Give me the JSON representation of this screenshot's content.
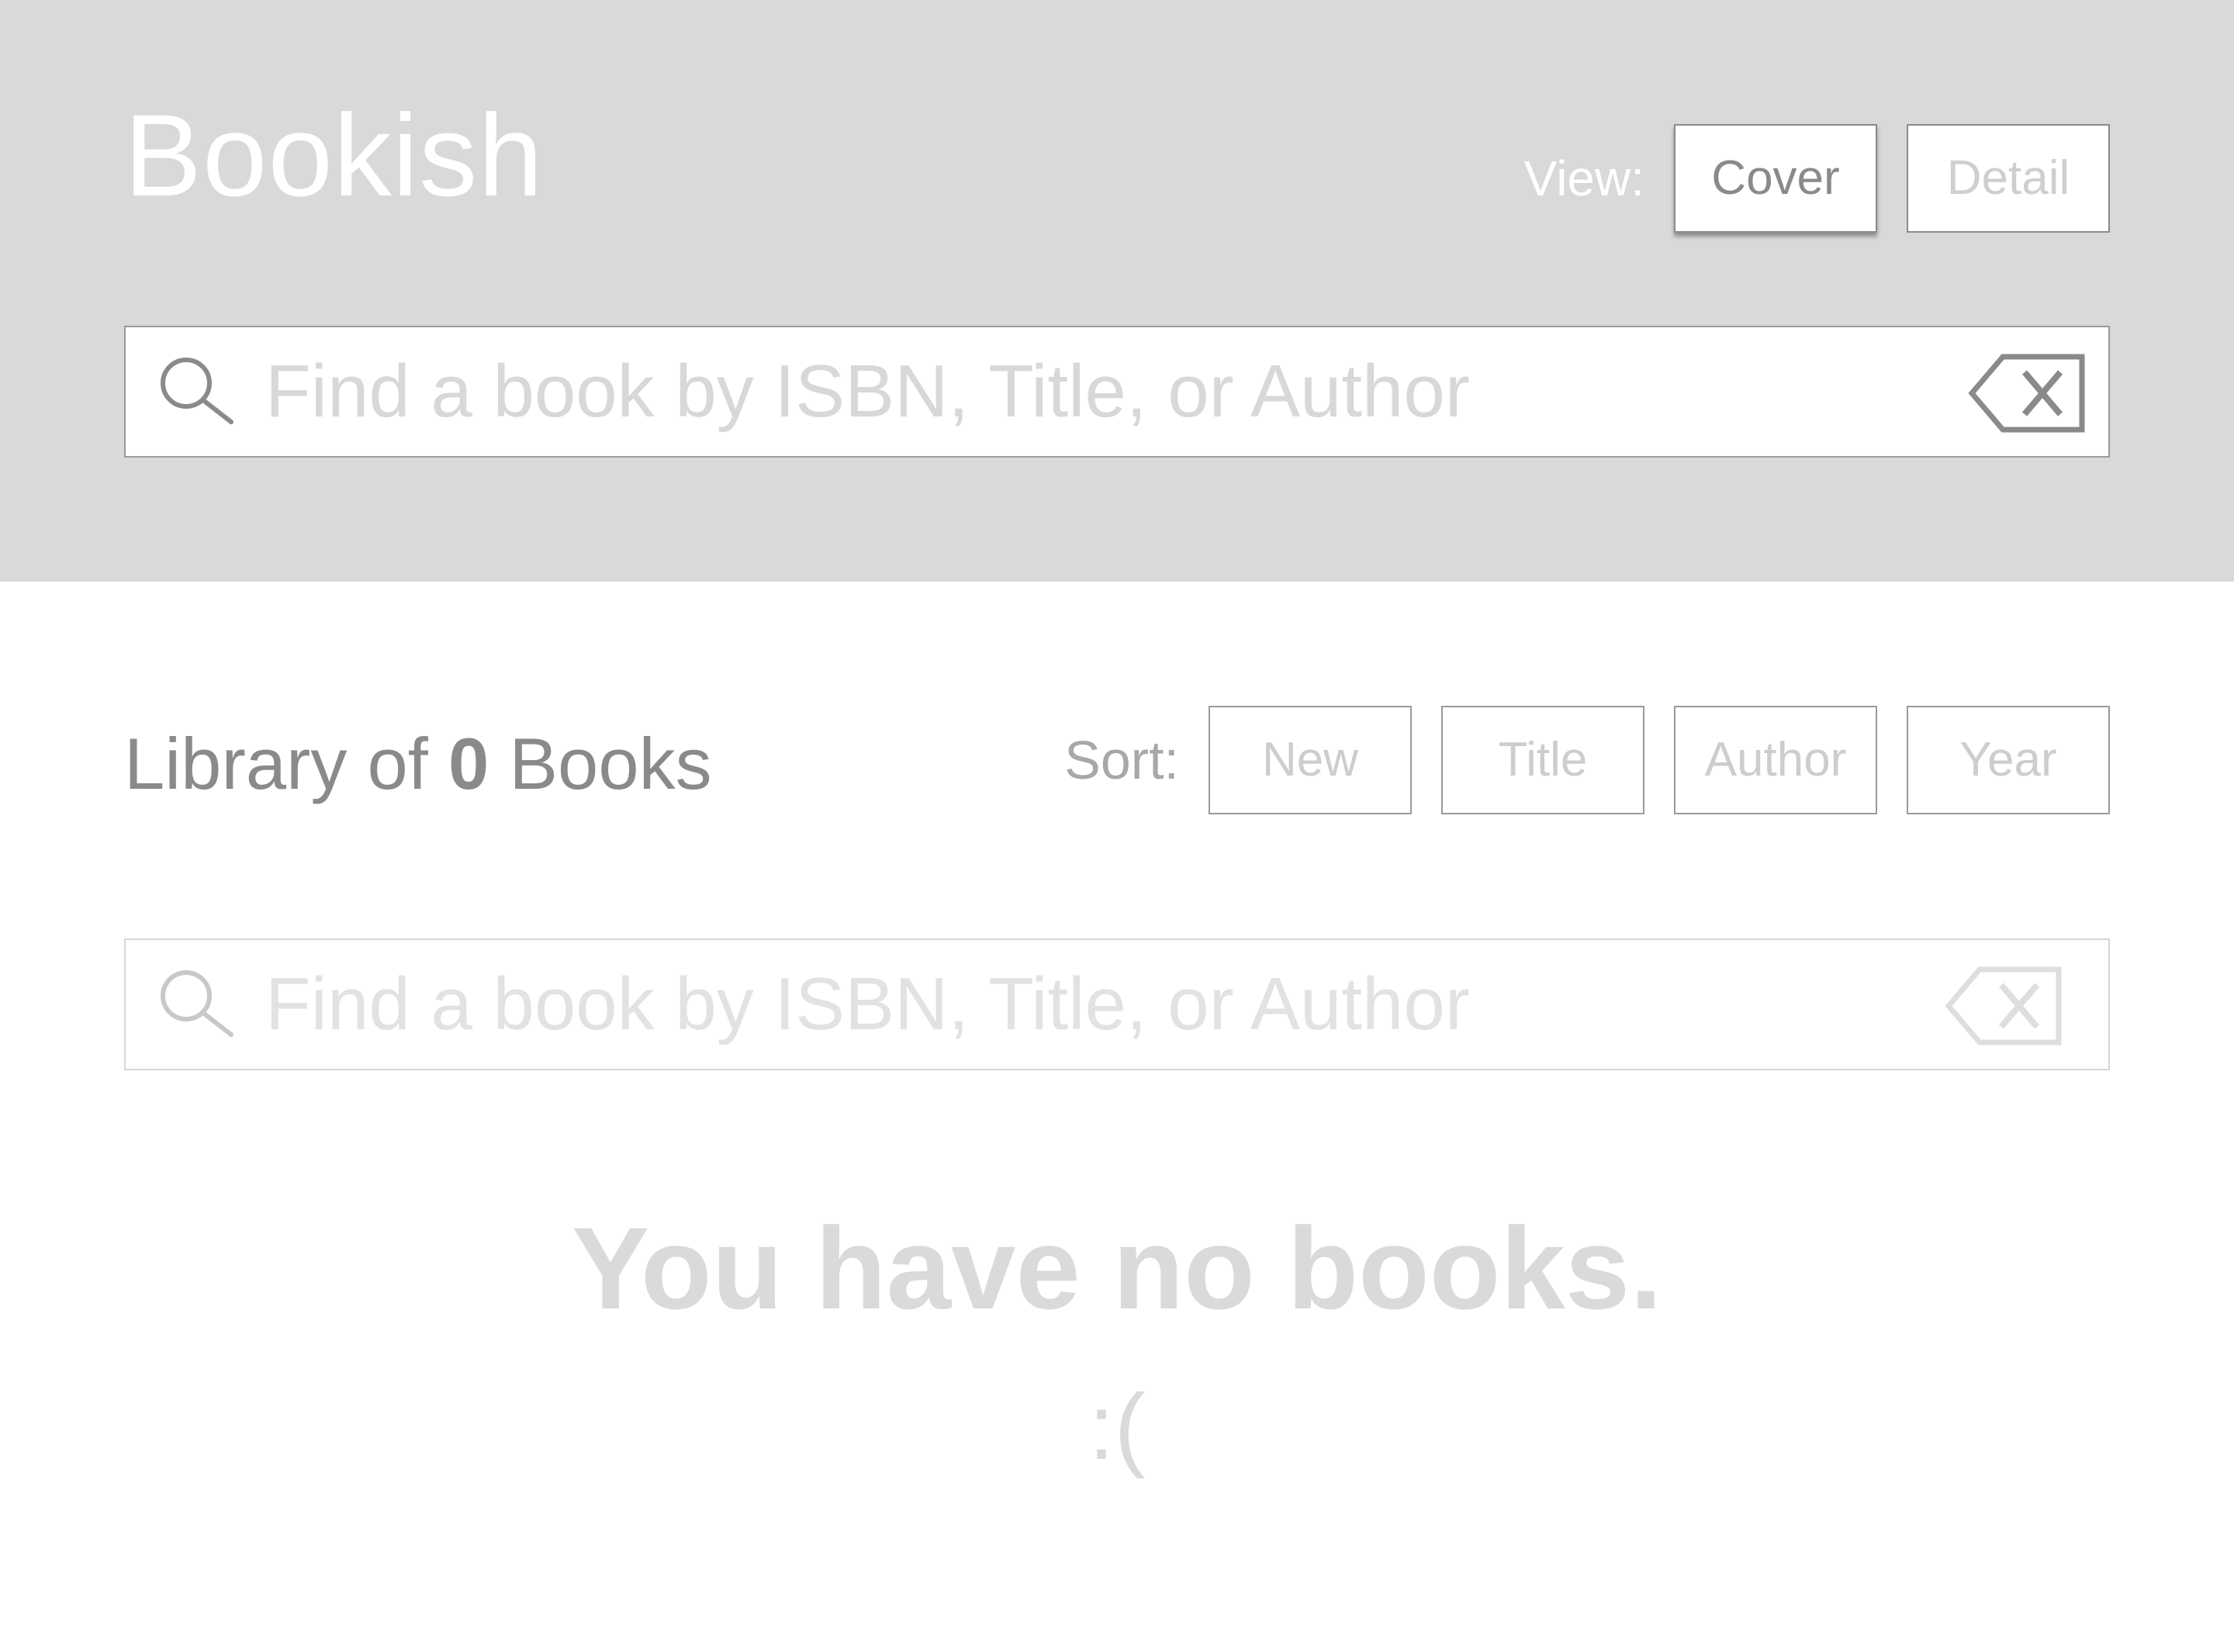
{
  "header": {
    "app_title": "Bookish",
    "view_label": "View:",
    "view_options": [
      {
        "label": "Cover",
        "active": true
      },
      {
        "label": "Detail",
        "active": false
      }
    ]
  },
  "search_top": {
    "placeholder": "Find a book by ISBN, Title, or Author",
    "value": ""
  },
  "library": {
    "prefix": "Library of ",
    "count": "0",
    "suffix": " Books",
    "sort_label": "Sort:",
    "sort_options": [
      {
        "label": "New"
      },
      {
        "label": "Title"
      },
      {
        "label": "Author"
      },
      {
        "label": "Year"
      }
    ]
  },
  "search_lower": {
    "placeholder": "Find a book by ISBN, Title, or Author",
    "value": ""
  },
  "empty_state": {
    "message": "You have no books.",
    "face": ":("
  },
  "colors": {
    "header_bg": "#d9d9d9",
    "title_text": "#ffffff",
    "primary_text": "#8a8a8a",
    "muted_text": "#d8d8d8"
  },
  "icons": {
    "search": "search-icon",
    "clear": "clear-backspace-icon"
  }
}
